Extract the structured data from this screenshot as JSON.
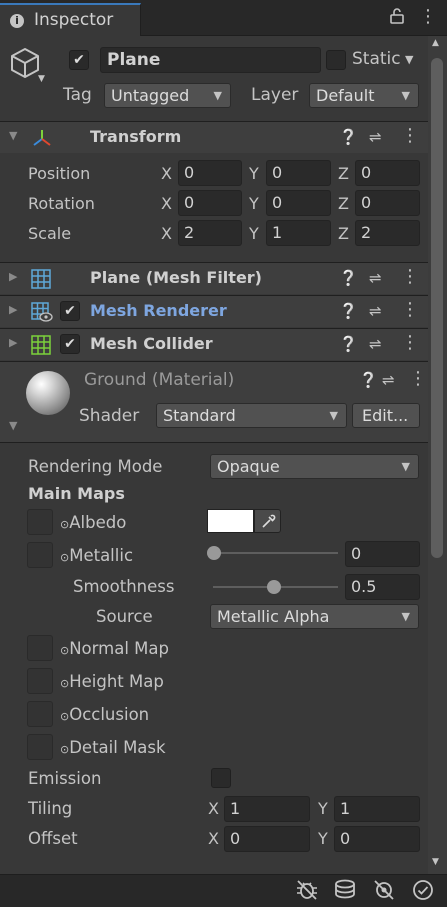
{
  "tab": {
    "label": "Inspector"
  },
  "object": {
    "name": "Plane",
    "active": true,
    "static_label": "Static",
    "tag_label": "Tag",
    "tag_value": "Untagged",
    "layer_label": "Layer",
    "layer_value": "Default"
  },
  "transform": {
    "title": "Transform",
    "rows": [
      {
        "label": "Position",
        "x": "0",
        "y": "0",
        "z": "0"
      },
      {
        "label": "Rotation",
        "x": "0",
        "y": "0",
        "z": "0"
      },
      {
        "label": "Scale",
        "x": "2",
        "y": "1",
        "z": "2"
      }
    ],
    "axis_x": "X",
    "axis_y": "Y",
    "axis_z": "Z"
  },
  "components": {
    "mesh_filter": "Plane (Mesh Filter)",
    "mesh_renderer": "Mesh Renderer",
    "mesh_collider": "Mesh Collider"
  },
  "material": {
    "title": "Ground (Material)",
    "shader_label": "Shader",
    "shader_value": "Standard",
    "edit_label": "Edit...",
    "rendering_mode_label": "Rendering Mode",
    "rendering_mode_value": "Opaque",
    "main_maps_label": "Main Maps",
    "albedo_label": "Albedo",
    "albedo_color": "#ffffff",
    "metallic_label": "Metallic",
    "metallic_value": "0",
    "smoothness_label": "Smoothness",
    "smoothness_value": "0.5",
    "source_label": "Source",
    "source_value": "Metallic Alpha",
    "normal_map_label": "Normal Map",
    "height_map_label": "Height Map",
    "occlusion_label": "Occlusion",
    "detail_mask_label": "Detail Mask",
    "emission_label": "Emission",
    "tiling_label": "Tiling",
    "tiling_x": "1",
    "tiling_y": "1",
    "offset_label": "Offset",
    "offset_x": "0",
    "offset_y": "0"
  },
  "colors": {
    "accent": "#3a79bb",
    "link_blue": "#7ea6e0",
    "background": "#383838"
  }
}
